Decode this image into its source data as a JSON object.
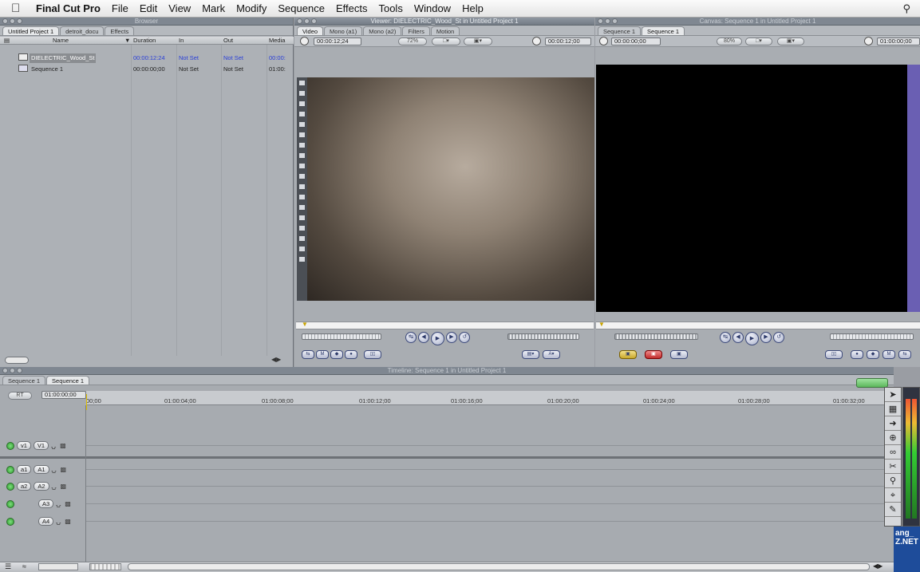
{
  "menubar": {
    "app": "Final Cut Pro",
    "items": [
      "File",
      "Edit",
      "View",
      "Mark",
      "Modify",
      "Sequence",
      "Effects",
      "Tools",
      "Window",
      "Help"
    ]
  },
  "browser": {
    "title": "Browser",
    "tabs": [
      "Untitled Project 1",
      "detroit_docu",
      "Effects"
    ],
    "columns": {
      "name": "Name",
      "duration": "Duration",
      "in": "In",
      "out": "Out",
      "media": "Media"
    },
    "rows": [
      {
        "name": "DIELECTRIC_Wood_St",
        "duration": "00:00:12:24",
        "in": "Not Set",
        "out": "Not Set",
        "media": "00:00:"
      },
      {
        "name": "Sequence 1",
        "duration": "00:00:00;00",
        "in": "Not Set",
        "out": "Not Set",
        "media": "01:00:"
      }
    ]
  },
  "viewer": {
    "title": "Viewer: DIELECTRIC_Wood_St in Untitled Project 1",
    "tabs": [
      "Video",
      "Mono (a1)",
      "Mono (a2)",
      "Filters",
      "Motion"
    ],
    "timecode_left": "00:00:12;24",
    "zoom": "72%",
    "timecode_right": "00:00:12;00"
  },
  "canvas": {
    "title": "Canvas: Sequence 1 in Untitled Project 1",
    "tabs": [
      "Sequence 1",
      "Sequence 1"
    ],
    "timecode_left": "00:00:00;00",
    "zoom": "80%",
    "timecode_right": "01:00:00;00"
  },
  "timeline": {
    "title": "Timeline: Sequence 1 in Untitled Project 1",
    "tabs": [
      "Sequence 1",
      "Sequence 1"
    ],
    "rt": "RT",
    "timecode": "01:00:00;00",
    "ruler": [
      "00;00",
      "01:00:04;00",
      "01:00:08;00",
      "01:00:12;00",
      "01:00:16;00",
      "01:00:20;00",
      "01:00:24;00",
      "01:00:28;00",
      "01:00:32;00"
    ],
    "video_tracks": [
      {
        "src": "v1",
        "dst": "V1"
      }
    ],
    "audio_tracks": [
      {
        "src": "a1",
        "dst": "A1"
      },
      {
        "src": "a2",
        "dst": "A2"
      },
      {
        "src": "",
        "dst": "A3"
      },
      {
        "src": "",
        "dst": "A4"
      }
    ]
  },
  "desktop_text": "ang_\nZ.NET",
  "colors": {
    "canvas_edge": "#6a5fb3",
    "desktop": "#1e4c9a"
  }
}
